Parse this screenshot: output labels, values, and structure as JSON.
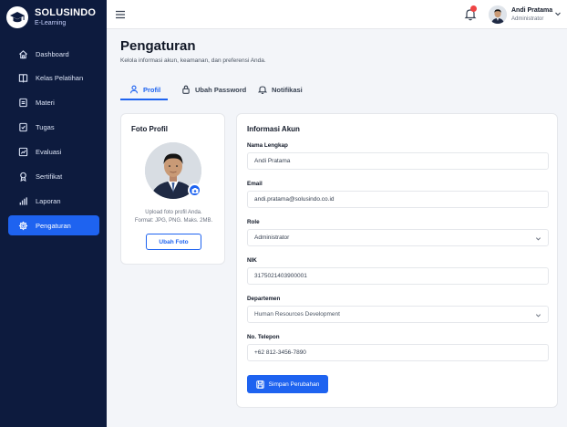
{
  "brand": {
    "name": "SOLUSINDO",
    "sub": "E-Learning",
    "icon": "graduation-cap-icon"
  },
  "sidebar": {
    "items": [
      {
        "label": "Dashboard",
        "icon": "home-icon",
        "active": false
      },
      {
        "label": "Kelas Pelatihan",
        "icon": "book-icon",
        "active": false
      },
      {
        "label": "Materi",
        "icon": "document-icon",
        "active": false
      },
      {
        "label": "Tugas",
        "icon": "checklist-icon",
        "active": false
      },
      {
        "label": "Evaluasi",
        "icon": "chart-line-icon",
        "active": false
      },
      {
        "label": "Sertifikat",
        "icon": "award-icon",
        "active": false
      },
      {
        "label": "Laporan",
        "icon": "bar-chart-icon",
        "active": false
      },
      {
        "label": "Pengaturan",
        "icon": "gear-icon",
        "active": true
      }
    ]
  },
  "topbar": {
    "notification_count": "",
    "user_name": "Andi Pratama",
    "user_role": "Administrator"
  },
  "page": {
    "title": "Pengaturan",
    "subtitle": "Kelola informasi akun, keamanan, dan preferensi Anda."
  },
  "tabs": [
    {
      "label": "Profil",
      "icon": "user-icon",
      "active": true
    },
    {
      "label": "Ubah Password",
      "icon": "lock-icon",
      "active": false
    },
    {
      "label": "Notifikasi",
      "icon": "bell-icon",
      "active": false
    }
  ],
  "photo_card": {
    "title": "Foto Profil",
    "hint_line1": "Upload foto profil Anda.",
    "hint_line2": "Format: JPG, PNG. Maks. 2MB.",
    "button": "Ubah Foto"
  },
  "info_card": {
    "title": "Informasi Akun",
    "fields": {
      "name": {
        "label": "Nama Lengkap",
        "value": "Andi Pratama"
      },
      "email": {
        "label": "Email",
        "value": "andi.pratama@solusindo.co.id"
      },
      "role": {
        "label": "Role",
        "value": "Administrator"
      },
      "nik": {
        "label": "NIK",
        "value": "3175021403900001"
      },
      "department": {
        "label": "Departemen",
        "value": "Human Resources Development"
      },
      "phone": {
        "label": "No. Telepon",
        "value": "+62 812-3456-7890"
      }
    },
    "save_button": "Simpan Perubahan"
  },
  "colors": {
    "sidebar_bg": "#0d1b3e",
    "accent": "#1e63f0",
    "badge": "#ef4444"
  }
}
